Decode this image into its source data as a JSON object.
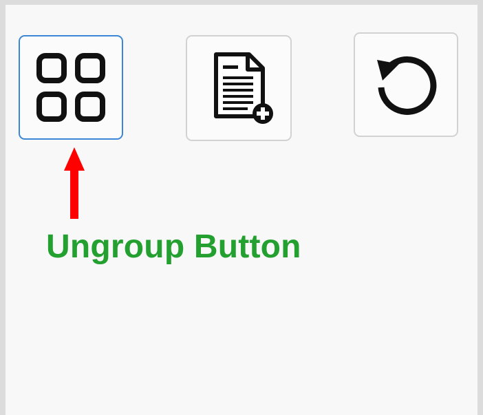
{
  "toolbar": {
    "buttons": [
      {
        "name": "ungroup",
        "icon": "ungroup-grid-icon",
        "selected": true
      },
      {
        "name": "new-document",
        "icon": "document-add-icon",
        "selected": false
      },
      {
        "name": "reset",
        "icon": "rotate-reset-icon",
        "selected": false
      }
    ]
  },
  "annotation": {
    "label": "Ungroup Button",
    "label_color": "#24a030",
    "arrow_color": "#ff0000",
    "highlight_color": "#3b86d6"
  }
}
